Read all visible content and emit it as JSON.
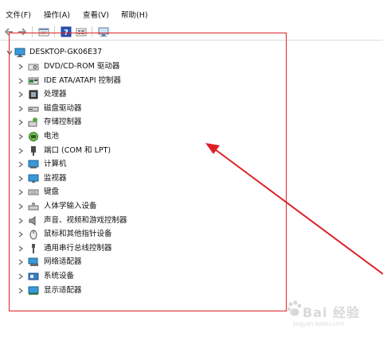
{
  "menubar": {
    "file": "文件(F)",
    "action": "操作(A)",
    "view": "查看(V)",
    "help": "帮助(H)"
  },
  "toolbar": {
    "buttons": [
      "back-icon",
      "forward-icon",
      "properties-icon",
      "help-icon",
      "details-icon",
      "monitor-icon"
    ]
  },
  "tree": {
    "root": "DESKTOP-GK06E37",
    "items": [
      {
        "label": "DVD/CD-ROM 驱动器",
        "icon": "dvd-drive-icon"
      },
      {
        "label": "IDE ATA/ATAPI 控制器",
        "icon": "ide-controller-icon"
      },
      {
        "label": "处理器",
        "icon": "processor-icon"
      },
      {
        "label": "磁盘驱动器",
        "icon": "disk-drive-icon"
      },
      {
        "label": "存储控制器",
        "icon": "storage-controller-icon"
      },
      {
        "label": "电池",
        "icon": "battery-icon"
      },
      {
        "label": "端口 (COM 和 LPT)",
        "icon": "port-icon"
      },
      {
        "label": "计算机",
        "icon": "computer-icon"
      },
      {
        "label": "监视器",
        "icon": "monitor-icon"
      },
      {
        "label": "键盘",
        "icon": "keyboard-icon"
      },
      {
        "label": "人体学输入设备",
        "icon": "hid-icon"
      },
      {
        "label": "声音、视频和游戏控制器",
        "icon": "sound-icon"
      },
      {
        "label": "鼠标和其他指针设备",
        "icon": "mouse-icon"
      },
      {
        "label": "通用串行总线控制器",
        "icon": "usb-icon"
      },
      {
        "label": "网络适配器",
        "icon": "network-adapter-icon"
      },
      {
        "label": "系统设备",
        "icon": "system-devices-icon"
      },
      {
        "label": "显示适配器",
        "icon": "display-adapter-icon"
      }
    ]
  },
  "annotation": {
    "color": "#e01f25"
  },
  "watermark": {
    "text": "Bai 经验",
    "subtext": "jingyan.baidu.com"
  }
}
